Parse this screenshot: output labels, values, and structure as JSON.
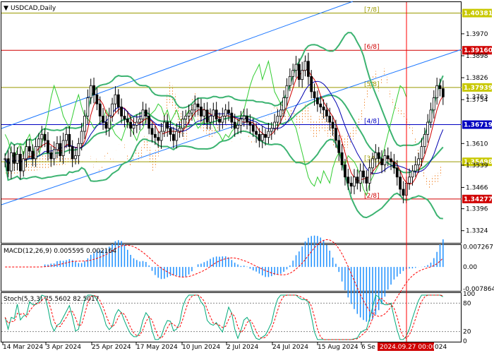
{
  "window": {
    "symbol": "USDCAD,Daily"
  },
  "colors": {
    "frame": "#000000",
    "up": "#000000",
    "down": "#000000",
    "bollinger": "#3cb371",
    "ma_fast": "#d00000",
    "ma_slow": "#0000b0",
    "trend": "#1e78ff",
    "murray": "#d00000",
    "murray_olive": "#9a9a00",
    "level_blue": "#0000c0",
    "ichimoku_cloud": "#f4a460",
    "lime": "#32cd32",
    "orange": "#ff8c00",
    "cursor": "#ff0000",
    "macd_hist": "#1e90ff",
    "macd_signal": "#ff0000",
    "stoch_main": "#00aa7a",
    "stoch_signal": "#ff0000"
  },
  "main_panel": {
    "price_range": [
      1.3284,
      1.4074
    ],
    "ticks": [
      "1.3970",
      "1.3898",
      "1.3826",
      "1.3754",
      "1.3610",
      "1.3539",
      "1.3466",
      "1.3396",
      "1.3324"
    ],
    "levels": [
      {
        "price": 1.4038,
        "label": "1.40381",
        "murray": "[7/8]",
        "kind": "olive"
      },
      {
        "price": 1.3916,
        "label": "1.39160",
        "murray": "[6/8]",
        "kind": "red"
      },
      {
        "price": 1.3794,
        "label": "1.37939",
        "murray": "[5/8]",
        "kind": "olive"
      },
      {
        "price": 1.3672,
        "label": "1.36719",
        "murray": "[4/8]",
        "kind": "blue"
      },
      {
        "price": 1.355,
        "label": "1.35498",
        "murray": "[3/8]",
        "kind": "olive"
      },
      {
        "price": 1.3428,
        "label": "1.34277",
        "murray": "[2/8]",
        "kind": "red"
      }
    ],
    "current_price_label": "1.3763"
  },
  "macd_panel": {
    "title": "MACD(12,26,9) 0.005595 0.002164",
    "ticks": [
      "0.007267",
      "0.00",
      "-0.007864"
    ],
    "range": [
      -0.0086,
      0.0079
    ]
  },
  "stoch_panel": {
    "title": "Stoch(5,3,3) 75.5602 82.5017",
    "ticks": [
      "100",
      "80",
      "20",
      "0"
    ]
  },
  "x_axis": {
    "labels": [
      "14 Mar 2024",
      "3 Apr 2024",
      "25 Apr 2024",
      "17 May 2024",
      "10 Jun 2024",
      "2 Jul 2024",
      "24 Jul 2024",
      "15 Aug 2024",
      "6 Se"
    ],
    "cursor_label": "2024.09.27 00:00",
    "after_cursor": "024"
  },
  "chart_data": {
    "type": "candlestick",
    "title": "USDCAD,Daily",
    "y_range": [
      1.3284,
      1.4074
    ],
    "closes": [
      1.356,
      1.352,
      1.358,
      1.3545,
      1.3575,
      1.352,
      1.356,
      1.36,
      1.3585,
      1.356,
      1.36,
      1.3625,
      1.364,
      1.362,
      1.358,
      1.356,
      1.359,
      1.361,
      1.357,
      1.362,
      1.364,
      1.36,
      1.356,
      1.357,
      1.361,
      1.365,
      1.37,
      1.376,
      1.38,
      1.377,
      1.374,
      1.37,
      1.368,
      1.366,
      1.37,
      1.374,
      1.377,
      1.373,
      1.37,
      1.369,
      1.368,
      1.366,
      1.367,
      1.368,
      1.369,
      1.372,
      1.37,
      1.366,
      1.364,
      1.363,
      1.362,
      1.365,
      1.368,
      1.366,
      1.364,
      1.362,
      1.365,
      1.366,
      1.369,
      1.37,
      1.371,
      1.372,
      1.374,
      1.373,
      1.37,
      1.372,
      1.368,
      1.37,
      1.372,
      1.369,
      1.368,
      1.37,
      1.372,
      1.371,
      1.368,
      1.366,
      1.367,
      1.369,
      1.37,
      1.368,
      1.367,
      1.365,
      1.364,
      1.362,
      1.364,
      1.363,
      1.365,
      1.366,
      1.368,
      1.37,
      1.372,
      1.376,
      1.38,
      1.383,
      1.385,
      1.387,
      1.382,
      1.385,
      1.388,
      1.383,
      1.378,
      1.376,
      1.374,
      1.373,
      1.372,
      1.37,
      1.368,
      1.366,
      1.362,
      1.358,
      1.354,
      1.35,
      1.348,
      1.347,
      1.35,
      1.348,
      1.352,
      1.35,
      1.348,
      1.353,
      1.356,
      1.358,
      1.356,
      1.354,
      1.357,
      1.356,
      1.355,
      1.353,
      1.35,
      1.346,
      1.344,
      1.348,
      1.35,
      1.352,
      1.354,
      1.356,
      1.36,
      1.364,
      1.368,
      1.372,
      1.376,
      1.38,
      1.379,
      1.3763
    ]
  }
}
